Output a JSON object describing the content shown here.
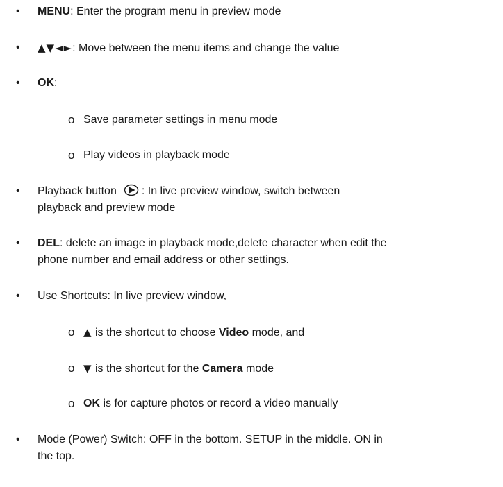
{
  "bullet_char": "•",
  "sub_bullet_char": "o",
  "items": [
    {
      "key": "MENU",
      "rest": ": Enter the program menu in preview mode"
    },
    {
      "key": "▲▼◄►",
      "rest": ": Move between the menu items and change the value"
    },
    {
      "key": "OK",
      "rest": ":"
    },
    {
      "text": "Save parameter settings in menu mode"
    },
    {
      "text": "Play videos in playback mode"
    },
    {
      "before": "Playback button",
      "after": ": In live preview window, switch between",
      "line2": "playback and preview mode"
    },
    {
      "key": "DEL",
      "rest": ": delete an image in playback mode,delete character when edit the",
      "line2": "phone number and email address or other settings."
    },
    {
      "text": "Use Shortcuts: In live preview window,"
    },
    {
      "glyph": "▲",
      "pre": " is the shortcut to choose ",
      "bold": "Video",
      "post": " mode, and"
    },
    {
      "glyph": "▼",
      "pre": " is the shortcut for the ",
      "bold": "Camera",
      "post": " mode"
    },
    {
      "key": "OK",
      "rest": " is for capture photos or record a video manually"
    },
    {
      "text": "Mode (Power) Switch: OFF in the bottom. SETUP in the middle. ON in",
      "line2": "the top."
    }
  ]
}
